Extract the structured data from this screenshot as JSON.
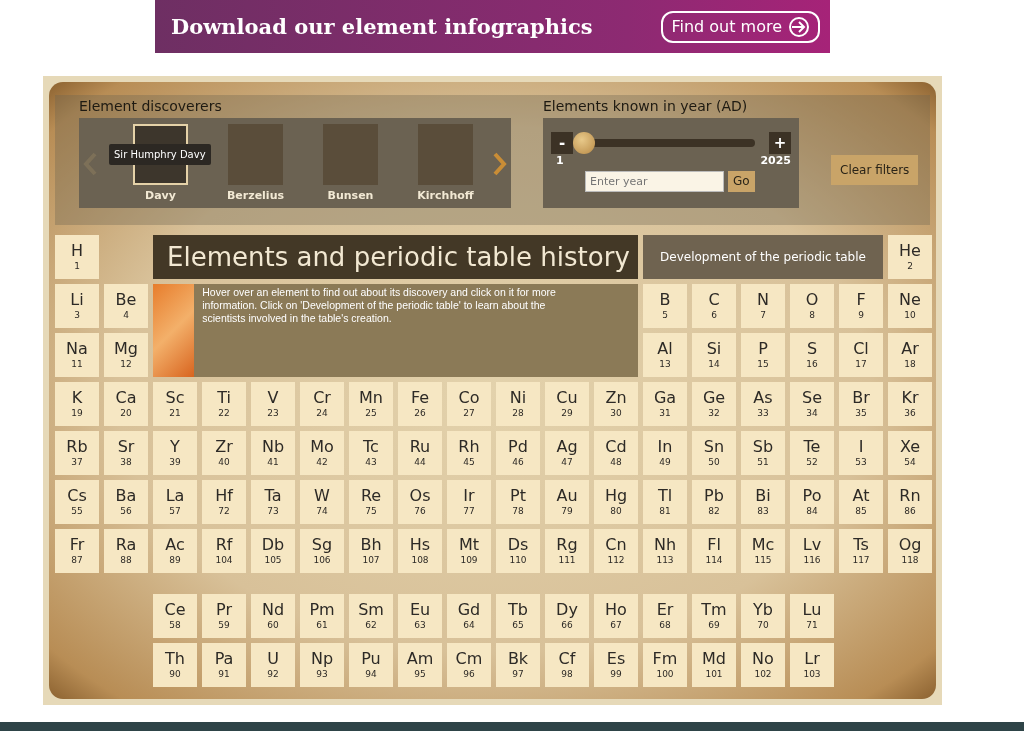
{
  "banner": {
    "text": "Download our element infographics",
    "button": "Find out more"
  },
  "discoverers": {
    "title": "Element discoverers",
    "tooltip": "Sir Humphry Davy",
    "prev_arrow": {
      "disabled": true
    },
    "next_arrow": {
      "disabled": false
    },
    "items": [
      {
        "name": "Davy",
        "selected": true
      },
      {
        "name": "Berzelius",
        "selected": false
      },
      {
        "name": "Bunsen",
        "selected": false
      },
      {
        "name": "Kirchhoff",
        "selected": false
      }
    ]
  },
  "year_filter": {
    "title": "Elements known in year (AD)",
    "minus": "-",
    "plus": "+",
    "level": 0,
    "min_label": "1",
    "max_label": "2025",
    "placeholder": "Enter year",
    "go": "Go"
  },
  "clear_filters": "Clear filters",
  "title": "Elements and periodic table history",
  "development_button": "Development of the periodic table",
  "intro": "Hover over an element to find out about its discovery and click on it for more information. Click on 'Development of the periodic table' to learn about the scientists involved in the table's creation.",
  "main_rows": [
    [
      {
        "symbol": "H",
        "number": "1"
      },
      {
        "symbol": "He",
        "number": "2"
      }
    ],
    [
      {
        "symbol": "Li",
        "number": "3"
      },
      {
        "symbol": "Be",
        "number": "4"
      },
      {
        "symbol": "B",
        "number": "5"
      },
      {
        "symbol": "C",
        "number": "6"
      },
      {
        "symbol": "N",
        "number": "7"
      },
      {
        "symbol": "O",
        "number": "8"
      },
      {
        "symbol": "F",
        "number": "9"
      },
      {
        "symbol": "Ne",
        "number": "10"
      }
    ],
    [
      {
        "symbol": "Na",
        "number": "11"
      },
      {
        "symbol": "Mg",
        "number": "12"
      },
      {
        "symbol": "Al",
        "number": "13"
      },
      {
        "symbol": "Si",
        "number": "14"
      },
      {
        "symbol": "P",
        "number": "15"
      },
      {
        "symbol": "S",
        "number": "16"
      },
      {
        "symbol": "Cl",
        "number": "17"
      },
      {
        "symbol": "Ar",
        "number": "18"
      }
    ],
    [
      {
        "symbol": "K",
        "number": "19"
      },
      {
        "symbol": "Ca",
        "number": "20"
      },
      {
        "symbol": "Sc",
        "number": "21"
      },
      {
        "symbol": "Ti",
        "number": "22"
      },
      {
        "symbol": "V",
        "number": "23"
      },
      {
        "symbol": "Cr",
        "number": "24"
      },
      {
        "symbol": "Mn",
        "number": "25"
      },
      {
        "symbol": "Fe",
        "number": "26"
      },
      {
        "symbol": "Co",
        "number": "27"
      },
      {
        "symbol": "Ni",
        "number": "28"
      },
      {
        "symbol": "Cu",
        "number": "29"
      },
      {
        "symbol": "Zn",
        "number": "30"
      },
      {
        "symbol": "Ga",
        "number": "31"
      },
      {
        "symbol": "Ge",
        "number": "32"
      },
      {
        "symbol": "As",
        "number": "33"
      },
      {
        "symbol": "Se",
        "number": "34"
      },
      {
        "symbol": "Br",
        "number": "35"
      },
      {
        "symbol": "Kr",
        "number": "36"
      }
    ],
    [
      {
        "symbol": "Rb",
        "number": "37"
      },
      {
        "symbol": "Sr",
        "number": "38"
      },
      {
        "symbol": "Y",
        "number": "39"
      },
      {
        "symbol": "Zr",
        "number": "40"
      },
      {
        "symbol": "Nb",
        "number": "41"
      },
      {
        "symbol": "Mo",
        "number": "42"
      },
      {
        "symbol": "Tc",
        "number": "43"
      },
      {
        "symbol": "Ru",
        "number": "44"
      },
      {
        "symbol": "Rh",
        "number": "45"
      },
      {
        "symbol": "Pd",
        "number": "46"
      },
      {
        "symbol": "Ag",
        "number": "47"
      },
      {
        "symbol": "Cd",
        "number": "48"
      },
      {
        "symbol": "In",
        "number": "49"
      },
      {
        "symbol": "Sn",
        "number": "50"
      },
      {
        "symbol": "Sb",
        "number": "51"
      },
      {
        "symbol": "Te",
        "number": "52"
      },
      {
        "symbol": "I",
        "number": "53"
      },
      {
        "symbol": "Xe",
        "number": "54"
      }
    ],
    [
      {
        "symbol": "Cs",
        "number": "55"
      },
      {
        "symbol": "Ba",
        "number": "56"
      },
      {
        "symbol": "La",
        "number": "57"
      },
      {
        "symbol": "Hf",
        "number": "72"
      },
      {
        "symbol": "Ta",
        "number": "73"
      },
      {
        "symbol": "W",
        "number": "74"
      },
      {
        "symbol": "Re",
        "number": "75"
      },
      {
        "symbol": "Os",
        "number": "76"
      },
      {
        "symbol": "Ir",
        "number": "77"
      },
      {
        "symbol": "Pt",
        "number": "78"
      },
      {
        "symbol": "Au",
        "number": "79"
      },
      {
        "symbol": "Hg",
        "number": "80"
      },
      {
        "symbol": "Tl",
        "number": "81"
      },
      {
        "symbol": "Pb",
        "number": "82"
      },
      {
        "symbol": "Bi",
        "number": "83"
      },
      {
        "symbol": "Po",
        "number": "84"
      },
      {
        "symbol": "At",
        "number": "85"
      },
      {
        "symbol": "Rn",
        "number": "86"
      }
    ],
    [
      {
        "symbol": "Fr",
        "number": "87"
      },
      {
        "symbol": "Ra",
        "number": "88"
      },
      {
        "symbol": "Ac",
        "number": "89"
      },
      {
        "symbol": "Rf",
        "number": "104"
      },
      {
        "symbol": "Db",
        "number": "105"
      },
      {
        "symbol": "Sg",
        "number": "106"
      },
      {
        "symbol": "Bh",
        "number": "107"
      },
      {
        "symbol": "Hs",
        "number": "108"
      },
      {
        "symbol": "Mt",
        "number": "109"
      },
      {
        "symbol": "Ds",
        "number": "110"
      },
      {
        "symbol": "Rg",
        "number": "111"
      },
      {
        "symbol": "Cn",
        "number": "112"
      },
      {
        "symbol": "Nh",
        "number": "113"
      },
      {
        "symbol": "Fl",
        "number": "114"
      },
      {
        "symbol": "Mc",
        "number": "115"
      },
      {
        "symbol": "Lv",
        "number": "116"
      },
      {
        "symbol": "Ts",
        "number": "117"
      },
      {
        "symbol": "Og",
        "number": "118"
      }
    ]
  ],
  "f_block_rows": [
    [
      {
        "symbol": "Ce",
        "number": "58"
      },
      {
        "symbol": "Pr",
        "number": "59"
      },
      {
        "symbol": "Nd",
        "number": "60"
      },
      {
        "symbol": "Pm",
        "number": "61"
      },
      {
        "symbol": "Sm",
        "number": "62"
      },
      {
        "symbol": "Eu",
        "number": "63"
      },
      {
        "symbol": "Gd",
        "number": "64"
      },
      {
        "symbol": "Tb",
        "number": "65"
      },
      {
        "symbol": "Dy",
        "number": "66"
      },
      {
        "symbol": "Ho",
        "number": "67"
      },
      {
        "symbol": "Er",
        "number": "68"
      },
      {
        "symbol": "Tm",
        "number": "69"
      },
      {
        "symbol": "Yb",
        "number": "70"
      },
      {
        "symbol": "Lu",
        "number": "71"
      }
    ],
    [
      {
        "symbol": "Th",
        "number": "90"
      },
      {
        "symbol": "Pa",
        "number": "91"
      },
      {
        "symbol": "U",
        "number": "92"
      },
      {
        "symbol": "Np",
        "number": "93"
      },
      {
        "symbol": "Pu",
        "number": "94"
      },
      {
        "symbol": "Am",
        "number": "95"
      },
      {
        "symbol": "Cm",
        "number": "96"
      },
      {
        "symbol": "Bk",
        "number": "97"
      },
      {
        "symbol": "Cf",
        "number": "98"
      },
      {
        "symbol": "Es",
        "number": "99"
      },
      {
        "symbol": "Fm",
        "number": "100"
      },
      {
        "symbol": "Md",
        "number": "101"
      },
      {
        "symbol": "No",
        "number": "102"
      },
      {
        "symbol": "Lr",
        "number": "103"
      }
    ]
  ]
}
